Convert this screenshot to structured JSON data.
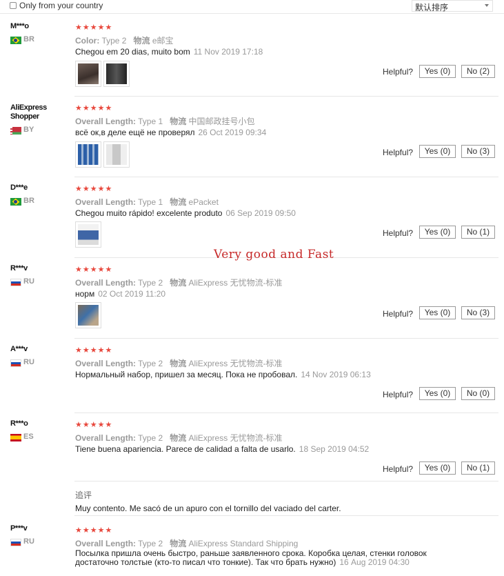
{
  "filter": {
    "checkbox_label": "Only from your country",
    "checked": false
  },
  "sort": {
    "selected": "默认排序"
  },
  "overlay_text": "Very good and Fast",
  "helpful_label": "Helpful?",
  "reviews": [
    {
      "user": "M***o",
      "country": "BR",
      "rating": "★★★★★",
      "attr1_name": "Color:",
      "attr1_value": "Type 2",
      "attr2_name": "物流",
      "attr2_value": "e邮宝",
      "text": "Chegou em 20 dias, muito bom",
      "date": "11 Nov 2019 17:18",
      "yes": "Yes (0)",
      "no": "No (2)"
    },
    {
      "user": "AliExpress Shopper",
      "country": "BY",
      "rating": "★★★★★",
      "attr1_name": "Overall Length:",
      "attr1_value": "Type 1",
      "attr2_name": "物流",
      "attr2_value": "中国邮政挂号小包",
      "text": "всё ок,в деле ещё не проверял",
      "date": "26 Oct 2019 09:34",
      "yes": "Yes (0)",
      "no": "No (3)"
    },
    {
      "user": "D***e",
      "country": "BR",
      "rating": "★★★★★",
      "attr1_name": "Overall Length:",
      "attr1_value": "Type 1",
      "attr2_name": "物流",
      "attr2_value": "ePacket",
      "text": "Chegou muito rápido! excelente produto",
      "date": "06 Sep 2019 09:50",
      "yes": "Yes (0)",
      "no": "No (1)"
    },
    {
      "user": "R***v",
      "country": "RU",
      "rating": "★★★★★",
      "attr1_name": "Overall Length:",
      "attr1_value": "Type 2",
      "attr2_name": "物流",
      "attr2_value": "AliExpress 无忧物流-标准",
      "text": "норм",
      "date": "02 Oct 2019 11:20",
      "yes": "Yes (0)",
      "no": "No (3)"
    },
    {
      "user": "A***v",
      "country": "RU",
      "rating": "★★★★★",
      "attr1_name": "Overall Length:",
      "attr1_value": "Type 2",
      "attr2_name": "物流",
      "attr2_value": "AliExpress 无忧物流-标准",
      "text": "Нормальный набор, пришел за месяц. Пока не пробовал.",
      "date": "14 Nov 2019 06:13",
      "yes": "Yes (0)",
      "no": "No (0)"
    },
    {
      "user": "R***o",
      "country": "ES",
      "rating": "★★★★★",
      "attr1_name": "Overall Length:",
      "attr1_value": "Type 2",
      "attr2_name": "物流",
      "attr2_value": "AliExpress 无忧物流-标准",
      "text": "Tiene buena apariencia. Parece de calidad a falta de usarlo.",
      "date": "18 Sep 2019 04:52",
      "yes": "Yes (0)",
      "no": "No (1)",
      "followup_label": "追评",
      "followup_text": "Muy contento. Me sacó de un apuro con el tornillo del vaciado del carter."
    },
    {
      "user": "P***v",
      "country": "RU",
      "rating": "★★★★★",
      "attr1_name": "Overall Length:",
      "attr1_value": "Type 2",
      "attr2_name": "物流",
      "attr2_value": "AliExpress Standard Shipping",
      "text": "Посылка пришла очень быстро, раньше заявленного срока. Коробка целая, стенки головок достаточно толстые (кто-то писал что тонкие). Так что брать нужно)",
      "date": "16 Aug 2019 04:30"
    }
  ],
  "colors": {
    "star": "#e8483d",
    "overlay": "#c62828",
    "muted": "#999999"
  }
}
